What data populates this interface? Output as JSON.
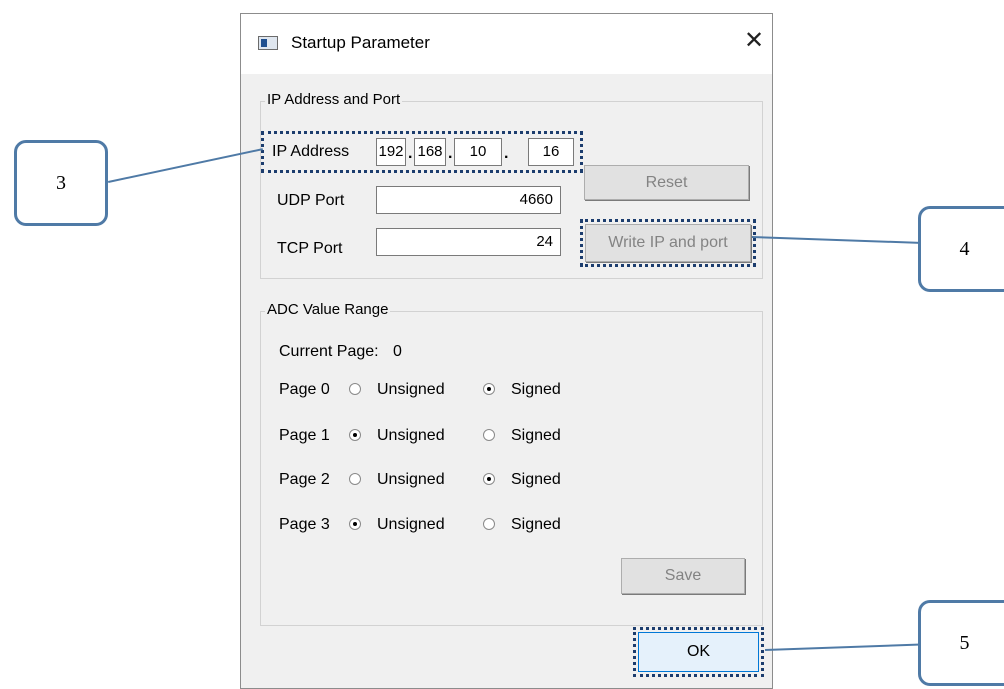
{
  "window": {
    "title": "Startup Parameter",
    "close_glyph": "✕",
    "icon": "app-window-icon"
  },
  "ip_group": {
    "title": "IP Address and Port",
    "ip_label": "IP Address",
    "octets": [
      "192",
      "168",
      "10",
      "16"
    ],
    "udp_label": "UDP Port",
    "udp_value": "4660",
    "tcp_label": "TCP Port",
    "tcp_value": "24",
    "reset_label": "Reset",
    "write_label": "Write IP and port"
  },
  "adc_group": {
    "title": "ADC Value Range",
    "current_page_label": "Current Page:",
    "current_page_value": "0",
    "unsigned_label": "Unsigned",
    "signed_label": "Signed",
    "pages": [
      {
        "label": "Page 0",
        "selected": "signed"
      },
      {
        "label": "Page 1",
        "selected": "unsigned"
      },
      {
        "label": "Page 2",
        "selected": "signed"
      },
      {
        "label": "Page 3",
        "selected": "unsigned"
      }
    ],
    "save_label": "Save"
  },
  "ok_label": "OK",
  "callouts": [
    "3",
    "4",
    "5"
  ],
  "colors": {
    "callout_border": "#4f7aa6",
    "focus_dots": "#1c3d6e",
    "dialog_bg": "#f0f0f0"
  }
}
